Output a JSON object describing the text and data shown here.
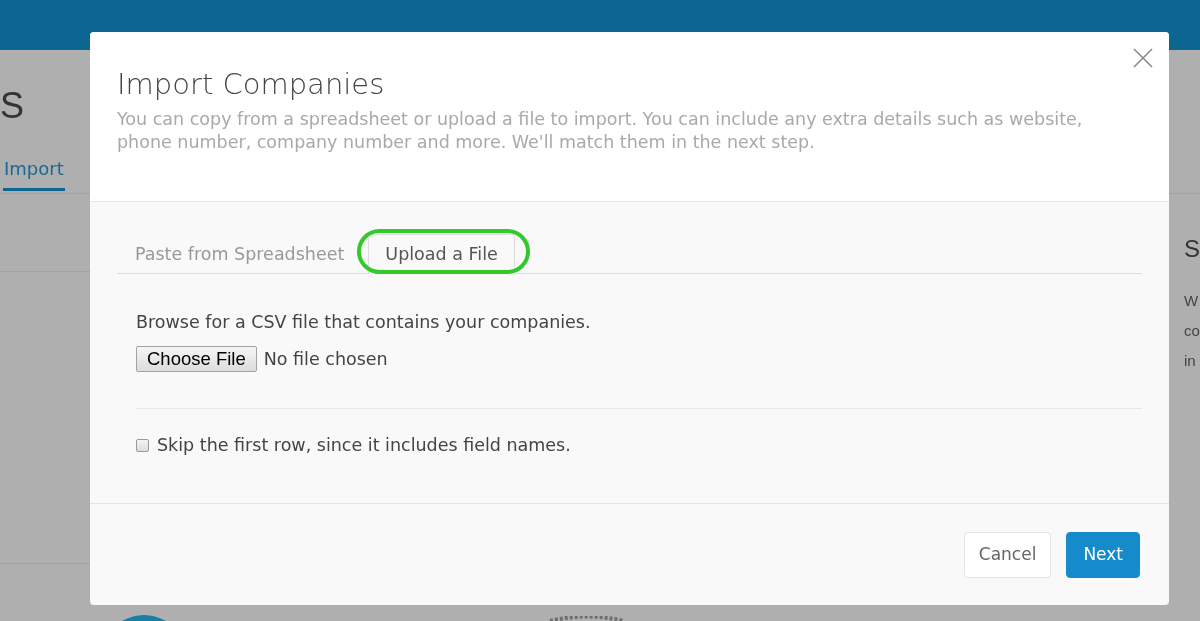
{
  "background_page": {
    "heading_fragment": "S",
    "tabs": [
      {
        "label": "Import",
        "selected": true
      }
    ],
    "side_panel": {
      "heading_fragment": "S",
      "text_fragments": [
        "W",
        "co",
        "in"
      ]
    }
  },
  "dialog": {
    "title": "Import Companies",
    "description": "You can copy from a spreadsheet or upload a file to import. You can include any extra details such as website, phone number, company number and more. We'll match them in the next step.",
    "tabs": [
      {
        "label": "Paste from Spreadsheet",
        "selected": false,
        "highlighted": false
      },
      {
        "label": "Upload a File",
        "selected": true,
        "highlighted": true
      }
    ],
    "instructions": "Browse for a CSV file that contains your companies.",
    "file_input": {
      "button": "Choose File",
      "status": "No file chosen"
    },
    "skip_first_row": {
      "label": "Skip the first row, since it includes field names.",
      "checked": false
    },
    "buttons": [
      {
        "label": "Cancel",
        "kind": "secondary"
      },
      {
        "label": "Next",
        "kind": "primary"
      }
    ]
  }
}
